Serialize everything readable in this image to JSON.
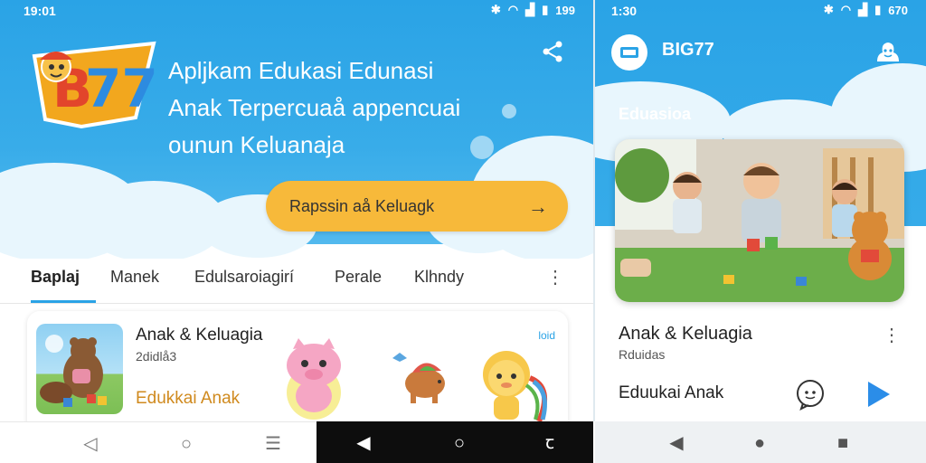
{
  "left": {
    "status": {
      "time": "19:01",
      "battery": "199"
    },
    "tagline": [
      "Apljkam Edukasi Edunasi",
      "Anak Terpercuaå appencuai",
      "ounun Keluanaja"
    ],
    "cta": {
      "label": "Rapssin aå Keluagk",
      "arrow": "→"
    },
    "tabs": [
      "Baplaj",
      "Manek",
      "Edulsaroiagirí",
      "Perale",
      "Klhndy"
    ],
    "tabs_more": "⋮",
    "card": {
      "title": "Anak & Keluagia",
      "subtitle": "2didlå3",
      "category": "Edukkai Anak",
      "badge": "loid"
    },
    "nav": {
      "back": "◁",
      "home": "○",
      "recents": "☰",
      "back2": "◀",
      "home2": "○",
      "assist": "ꞇ"
    }
  },
  "right": {
    "status": {
      "time": "1:30",
      "battery": "670"
    },
    "app_name": "BIG77",
    "section": "Eduasioa",
    "card": {
      "title": "Anak & Keluagia",
      "subtitle": "Rduidas",
      "category": "Eduukai Anak",
      "more": "⋮"
    },
    "nav": {
      "back": "◀",
      "home": "●",
      "recents": "■"
    }
  },
  "colors": {
    "primary": "#2aa3e6",
    "cta": "#f7b93a",
    "accent_text": "#d08a1e"
  }
}
